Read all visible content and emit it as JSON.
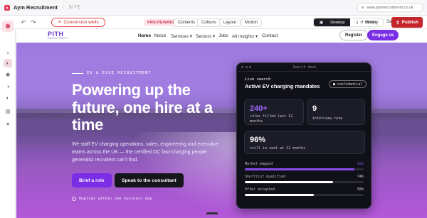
{
  "topbar": {
    "site_name": "Aym Recruitment",
    "separator": "/",
    "section": "SITE",
    "url": "www.aymrecruitment.co.uk"
  },
  "toolbar": {
    "conversion_label": "Conversion wells",
    "previewing_label": "PREVIEWING",
    "tabs": [
      "Contents",
      "Colours",
      "Layout",
      "Motion"
    ],
    "device_desktop": "Desktop",
    "device_mobile": "Mobile",
    "history": "History",
    "saved": "Saved",
    "publish": "Publish"
  },
  "site_nav": {
    "logo": "PITH",
    "logo_sub": "RECRUITMENT",
    "links": [
      "Home",
      "About",
      "Services ▾",
      "Sectors ▾",
      "Jobs",
      "All insights ▾",
      "Contact"
    ],
    "register": "Register",
    "engage": "Engage us"
  },
  "hero": {
    "eyebrow": "EV & EVSE RECRUITMENT",
    "headline": "Powering up the future, one hire at a time",
    "subcopy": "We staff EV charging operations, sales, engineering and executive teams across the UK — the certified DC fast-charging people generalist recruiters can't find.",
    "primary_cta": "Brief a role",
    "secondary_cta": "Speak to the consultant",
    "reply_note": "Replies within one business day"
  },
  "dashboard": {
    "window_title": "Search desk",
    "live_label": "Live search",
    "mandates": "Active EV charging mandates",
    "confidential": "confidential",
    "stats": [
      {
        "value": "240+",
        "label": "roles filled last 12 months"
      },
      {
        "value": "9",
        "label": "interview rate"
      },
      {
        "value": "96%",
        "label": "still in seat at 12 months"
      }
    ],
    "bars": [
      {
        "label": "Market mapped",
        "value": "92%",
        "fraction": 0.92
      },
      {
        "label": "Shortlist qualified",
        "value": "74%",
        "fraction": 0.74
      },
      {
        "label": "Offer accepted",
        "value": "58%",
        "fraction": 0.58
      }
    ]
  },
  "colors": {
    "accent": "#7a2ee6",
    "publish": "#c4252a",
    "conversion": "#cc3333"
  }
}
